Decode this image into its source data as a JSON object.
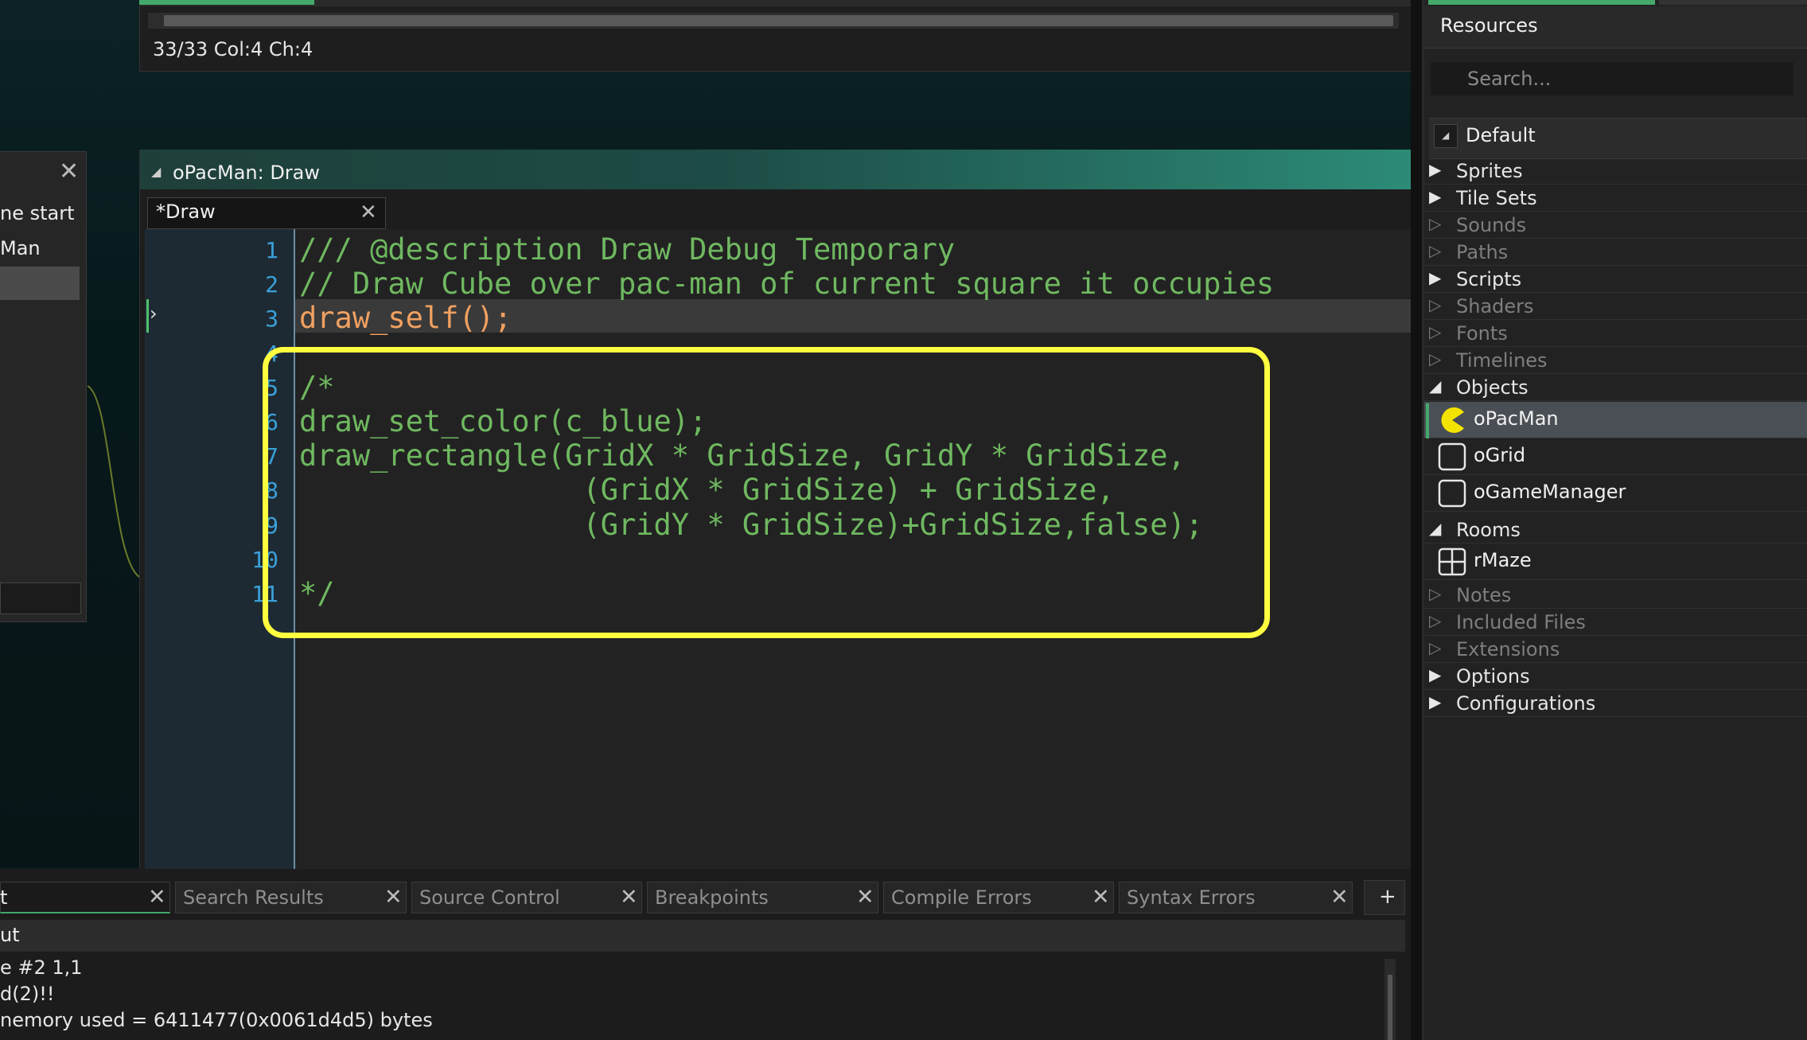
{
  "top_editor": {
    "status": "33/33 Col:4 Ch:4"
  },
  "left_panel": {
    "items": [
      "ne start",
      "Man"
    ]
  },
  "editor": {
    "title": "oPacMan: Draw",
    "tab_label": "*Draw",
    "current_line": 3,
    "lines": [
      {
        "n": "1",
        "text": "/// @description Draw Debug Temporary"
      },
      {
        "n": "2",
        "text": "// Draw Cube over pac-man of current square it occupies"
      },
      {
        "n": "3",
        "text": "draw_self();"
      },
      {
        "n": "4",
        "text": ""
      },
      {
        "n": "5",
        "text": "/*"
      },
      {
        "n": "6",
        "text": "draw_set_color(c_blue);"
      },
      {
        "n": "7",
        "text": "draw_rectangle(GridX * GridSize, GridY * GridSize,"
      },
      {
        "n": "8",
        "text": "                (GridX * GridSize) + GridSize,"
      },
      {
        "n": "9",
        "text": "                (GridY * GridSize)+GridSize,false);"
      },
      {
        "n": "10",
        "text": ""
      },
      {
        "n": "11",
        "text": "*/"
      }
    ]
  },
  "output": {
    "tabs": [
      {
        "label": "t",
        "active": true
      },
      {
        "label": "Search Results",
        "active": false
      },
      {
        "label": "Source Control",
        "active": false
      },
      {
        "label": "Breakpoints",
        "active": false
      },
      {
        "label": "Compile Errors",
        "active": false
      },
      {
        "label": "Syntax Errors",
        "active": false
      }
    ],
    "add_tab_label": "+",
    "header": "ut",
    "lines": [
      "e #2 1,1",
      "d(2)!!",
      "nemory used = 6411477(0x0061d4d5) bytes"
    ]
  },
  "resources": {
    "title": "Resources",
    "search_placeholder": "Search...",
    "group": "Default",
    "tree": {
      "sprites": "Sprites",
      "tilesets": "Tile Sets",
      "sounds": "Sounds",
      "paths": "Paths",
      "scripts": "Scripts",
      "shaders": "Shaders",
      "fonts": "Fonts",
      "timelines": "Timelines",
      "objects": "Objects",
      "objects_children": [
        "oPacMan",
        "oGrid",
        "oGameManager"
      ],
      "rooms": "Rooms",
      "rooms_children": [
        "rMaze"
      ],
      "notes": "Notes",
      "included_files": "Included Files",
      "extensions": "Extensions",
      "options": "Options",
      "configurations": "Configurations"
    }
  },
  "colors": {
    "accent_green": "#44a86a",
    "highlight_yellow": "#ffff40",
    "code_green": "#6fb860",
    "line_number_blue": "#3aa0d8"
  }
}
